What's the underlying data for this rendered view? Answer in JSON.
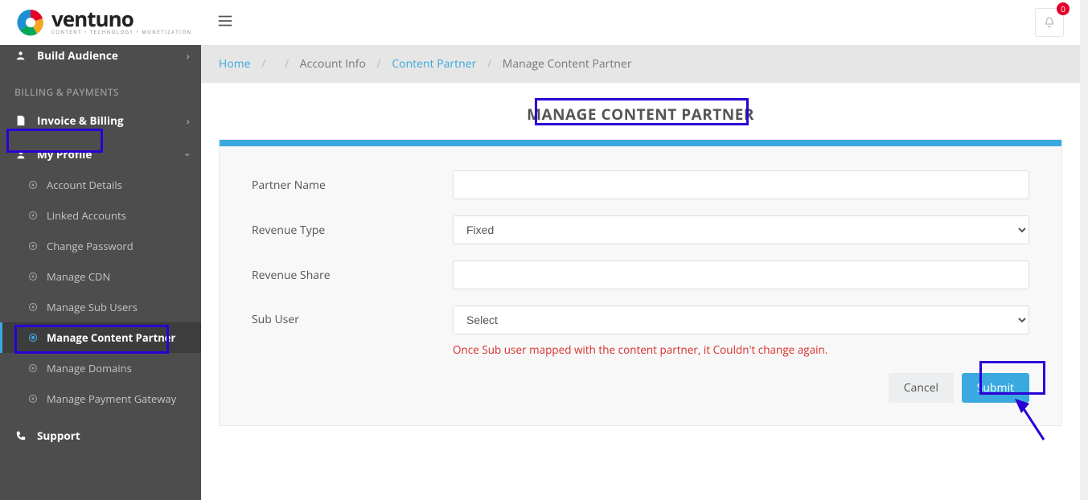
{
  "brand": {
    "name": "ventuno",
    "tagline": "CONTENT • TECHNOLOGY • MONETIZATION"
  },
  "header": {
    "notif_count": "0"
  },
  "sidebar": {
    "build_audience": "Build Audience",
    "section_billing": "BILLING & PAYMENTS",
    "invoice_billing": "Invoice & Billing",
    "my_profile": "My Profile",
    "items": {
      "account_details": "Account Details",
      "linked_accounts": "Linked Accounts",
      "change_password": "Change Password",
      "manage_cdn": "Manage CDN",
      "manage_sub_users": "Manage Sub Users",
      "manage_content_partner": "Manage Content Partner",
      "manage_domains": "Manage Domains",
      "manage_payment_gateway": "Manage Payment Gateway"
    },
    "support": "Support"
  },
  "breadcrumb": {
    "home": "Home",
    "account_info": "Account Info",
    "content_partner": "Content Partner",
    "current": "Manage Content Partner"
  },
  "page_title": "MANAGE CONTENT PARTNER",
  "form": {
    "labels": {
      "partner_name": "Partner Name",
      "revenue_type": "Revenue Type",
      "revenue_share": "Revenue Share",
      "sub_user": "Sub User"
    },
    "values": {
      "partner_name": "",
      "revenue_type": "Fixed",
      "revenue_share": "",
      "sub_user": "Select"
    },
    "help_sub_user": "Once Sub user mapped with the content partner, it Couldn't change again.",
    "buttons": {
      "cancel": "Cancel",
      "submit": "Submit"
    }
  }
}
